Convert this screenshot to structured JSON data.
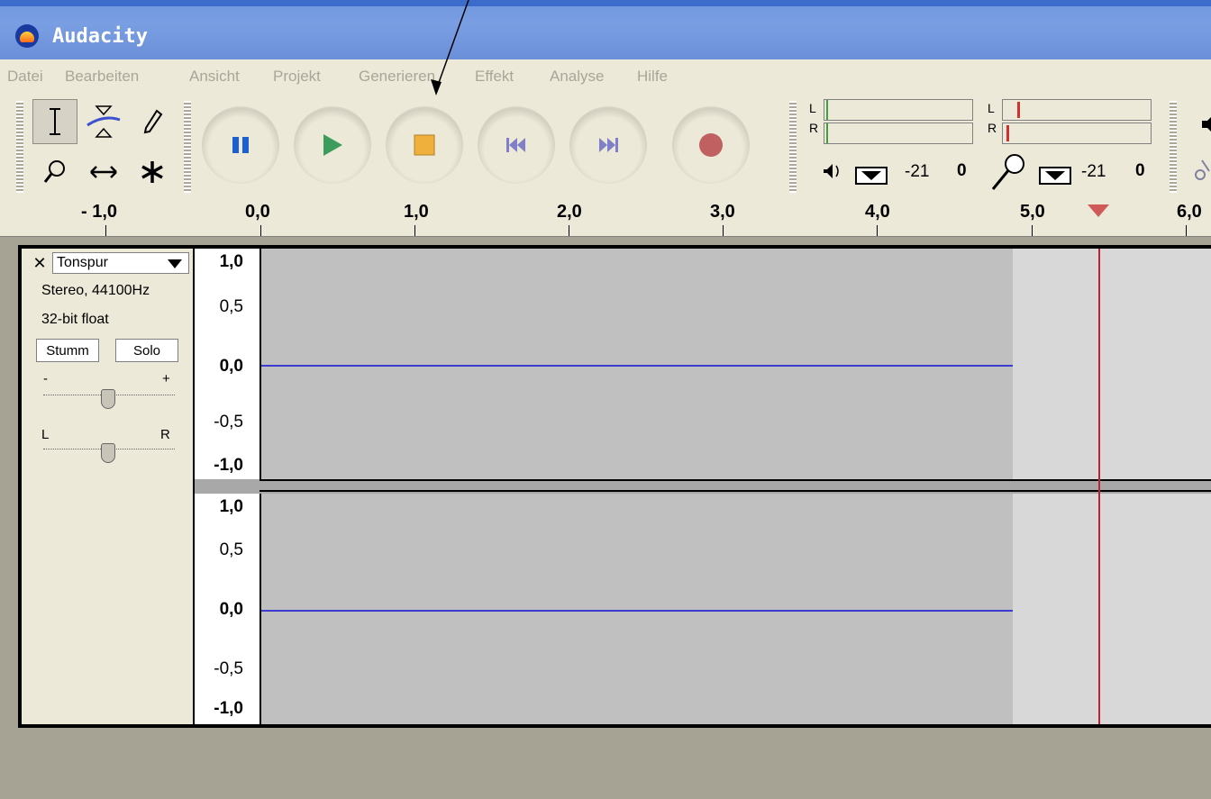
{
  "window": {
    "title": "Audacity"
  },
  "menu": [
    "Datei",
    "Bearbeiten",
    "Ansicht",
    "Projekt",
    "Generieren",
    "Effekt",
    "Analyse",
    "Hilfe"
  ],
  "tools": {
    "selection": "selection-tool",
    "envelope": "envelope-tool",
    "draw": "draw-tool",
    "zoom": "zoom-tool",
    "timeshift": "timeshift-tool",
    "multi": "multi-tool"
  },
  "transport": [
    "pause",
    "play",
    "stop",
    "skip-start",
    "skip-end",
    "record"
  ],
  "colors": {
    "pause": "#1c5fcf",
    "play": "#3c9c5c",
    "stop": "#f0b03c",
    "skip": "#8080c8",
    "record": "#c03a3a",
    "wave": "#3c3cd0",
    "playhead": "#c0203a"
  },
  "meters": {
    "output": {
      "left_label": "L",
      "right_label": "R",
      "scale_a": "-21",
      "scale_b": "0"
    },
    "input": {
      "left_label": "L",
      "right_label": "R",
      "scale_a": "-21",
      "scale_b": "0"
    }
  },
  "ruler": [
    "- 1,0",
    "0,0",
    "1,0",
    "2,0",
    "3,0",
    "4,0",
    "5,0",
    "6,0"
  ],
  "track": {
    "name": "Tonspur",
    "info_rate": "Stereo, 44100Hz",
    "info_format": "32-bit float",
    "mute": "Stumm",
    "solo": "Solo",
    "gain_minus": "-",
    "gain_plus": "+",
    "pan_left": "L",
    "pan_right": "R",
    "gain_level": 0.5,
    "pan_level": 0.5
  },
  "vruler": {
    "top": [
      "1,0",
      "0,5",
      "0,0",
      "-0,5",
      "-1,0"
    ],
    "bottom": [
      "1,0",
      "0,5",
      "0,0",
      "-0,5",
      "-1,0"
    ]
  }
}
